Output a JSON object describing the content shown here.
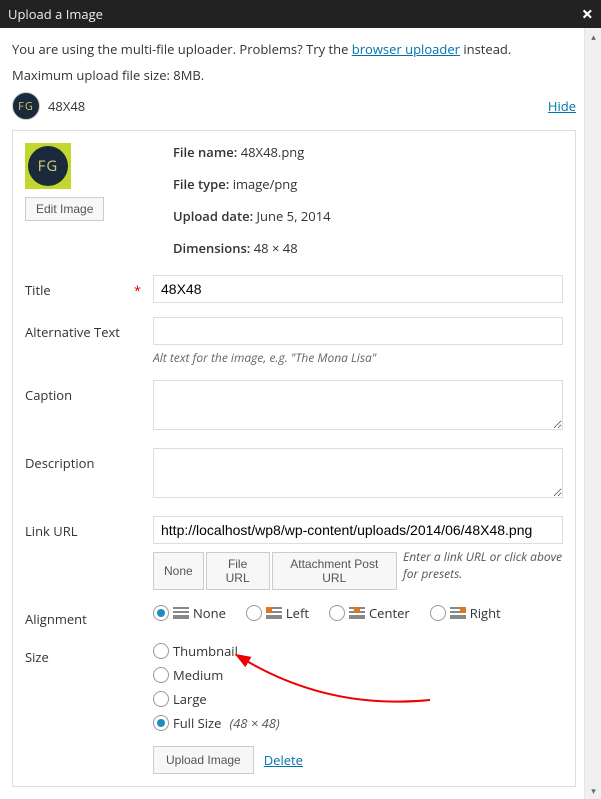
{
  "titlebar": {
    "title": "Upload a Image"
  },
  "intro": {
    "prefix": "You are using the multi-file uploader. Problems? Try the ",
    "link": "browser uploader",
    "suffix": " instead."
  },
  "maxsize": "Maximum upload file size: 8MB.",
  "uploaded": {
    "name": "48X48",
    "hide": "Hide"
  },
  "meta": {
    "filename_label": "File name:",
    "filename": "48X48.png",
    "filetype_label": "File type:",
    "filetype": "image/png",
    "date_label": "Upload date:",
    "date": "June 5, 2014",
    "dims_label": "Dimensions:",
    "dims": "48 × 48",
    "edit": "Edit Image"
  },
  "form": {
    "title_label": "Title",
    "title_value": "48X48",
    "alt_label": "Alternative Text",
    "alt_value": "",
    "alt_hint": "Alt text for the image, e.g. \"The Mona Lisa\"",
    "caption_label": "Caption",
    "caption_value": "",
    "desc_label": "Description",
    "desc_value": "",
    "url_label": "Link URL",
    "url_value": "http://localhost/wp8/wp-content/uploads/2014/06/48X48.png",
    "url_none": "None",
    "url_file": "File URL",
    "url_post": "Attachment Post URL",
    "url_hint": "Enter a link URL or click above for presets.",
    "align_label": "Alignment",
    "align_none": "None",
    "align_left": "Left",
    "align_center": "Center",
    "align_right": "Right",
    "size_label": "Size",
    "size_thumb": "Thumbnail",
    "size_med": "Medium",
    "size_large": "Large",
    "size_full": "Full Size",
    "size_full_dims": "(48 × 48)"
  },
  "actions": {
    "upload": "Upload Image",
    "delete": "Delete"
  }
}
